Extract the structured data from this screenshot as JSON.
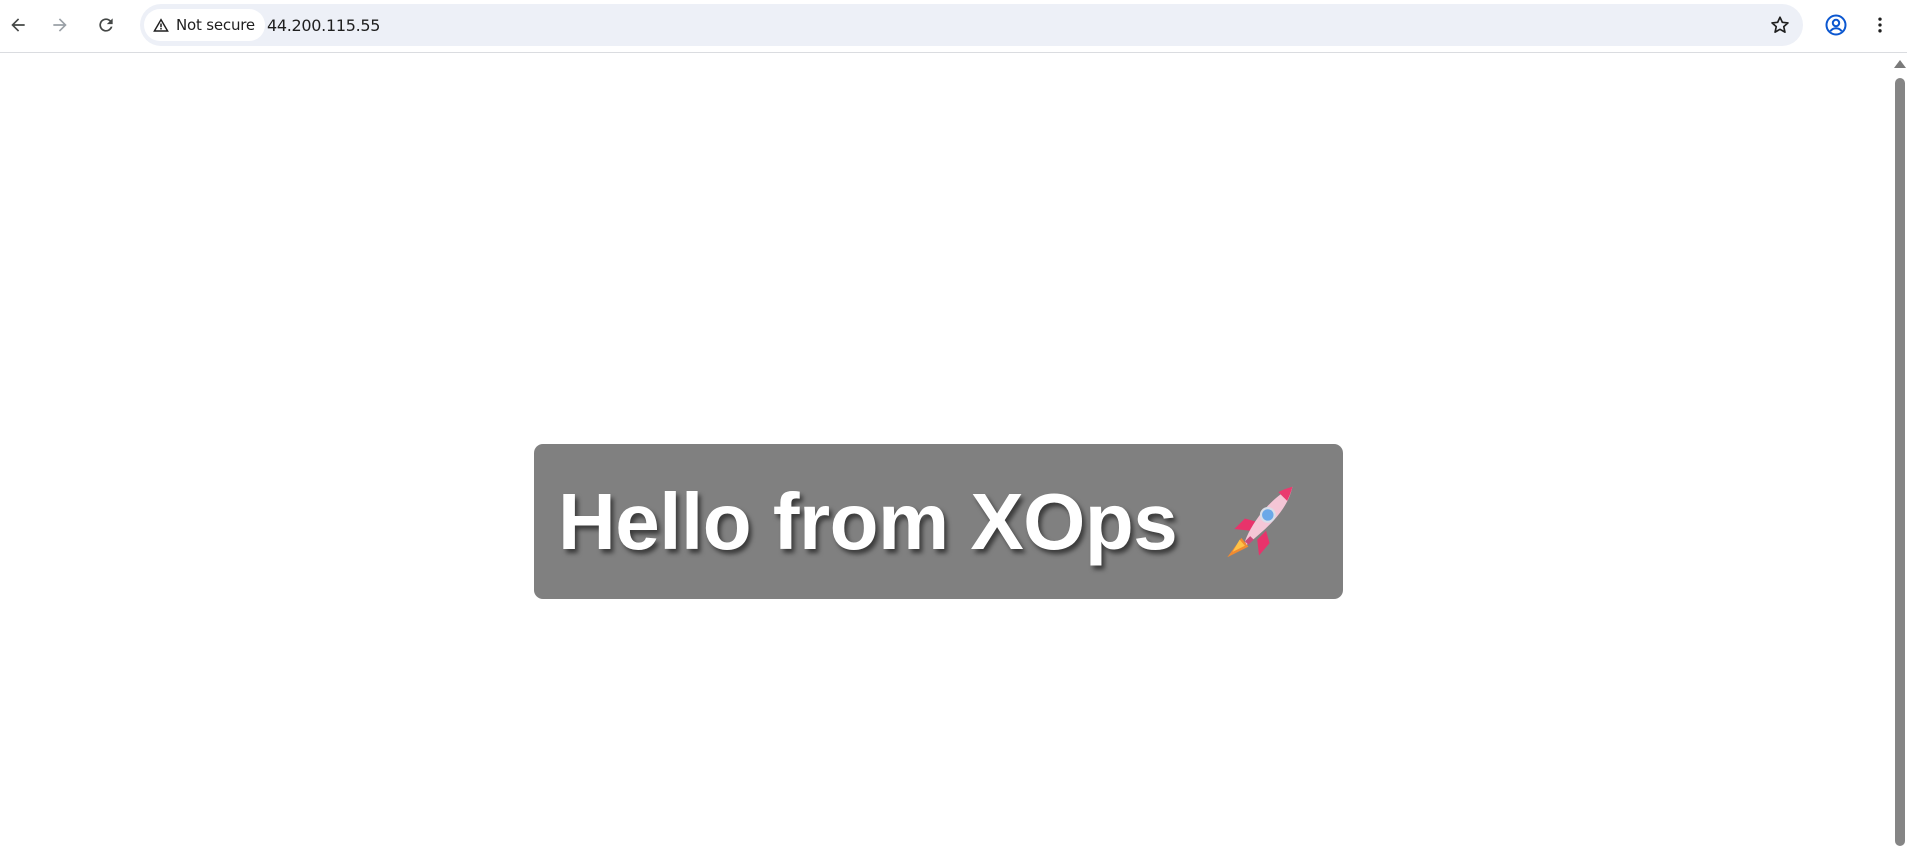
{
  "browser": {
    "security_label": "Not secure",
    "url": "44.200.115.55",
    "icons": {
      "back": "back-arrow-icon",
      "forward": "forward-arrow-icon",
      "reload": "reload-icon",
      "security": "warning-triangle-icon",
      "bookmark": "star-icon",
      "profile": "profile-icon",
      "menu": "kebab-menu-icon"
    }
  },
  "page": {
    "heading": "Hello from XOps",
    "heading_icon": "rocket-icon",
    "box_color": "#808080",
    "text_color": "#ffffff"
  }
}
